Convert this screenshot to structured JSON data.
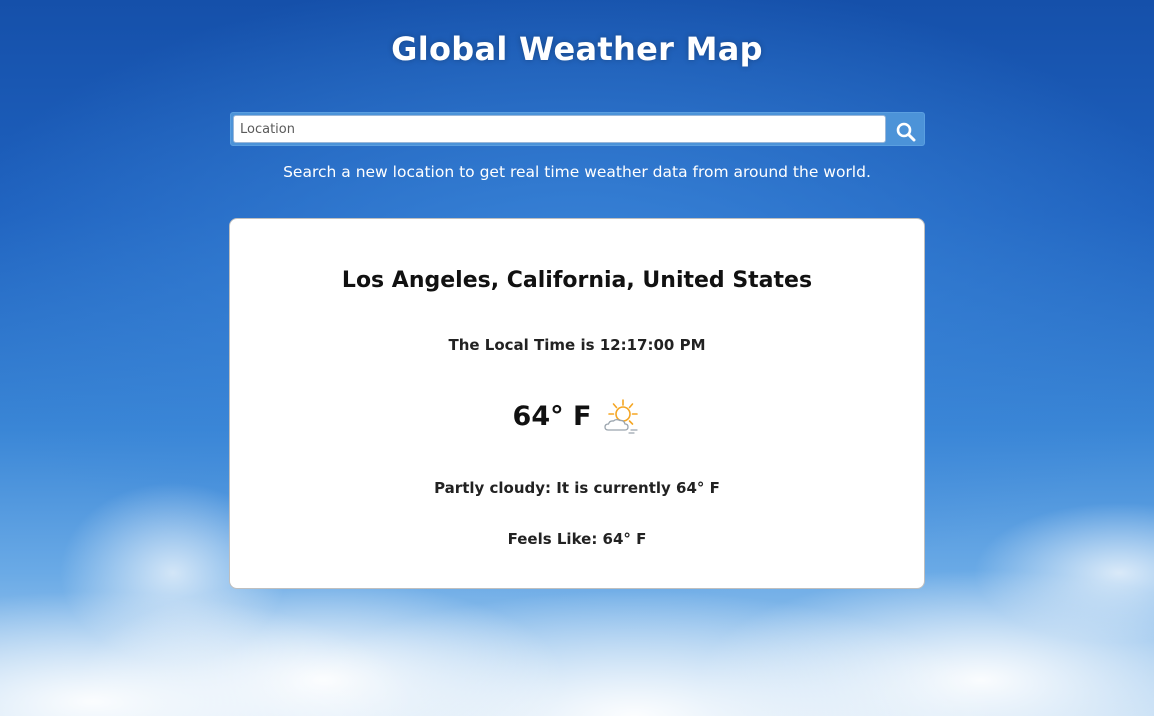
{
  "header": {
    "title": "Global Weather Map"
  },
  "search": {
    "placeholder": "Location",
    "value": "",
    "button_icon": "search-icon"
  },
  "subtitle": "Search a new location to get real time weather data from around the world.",
  "weather": {
    "location": "Los Angeles, California, United States",
    "local_time": "The Local Time is 12:17:00 PM",
    "temperature": "64° F",
    "condition_icon": "partly-cloudy-icon",
    "condition_text": "Partly cloudy: It is currently 64° F",
    "feels_like": "Feels Like: 64° F"
  },
  "colors": {
    "sky_top": "#1550aa",
    "search_bar_accent": "#4c93d8",
    "sun_orange": "#f5a623",
    "cloud_gray": "#9aa4ad"
  }
}
